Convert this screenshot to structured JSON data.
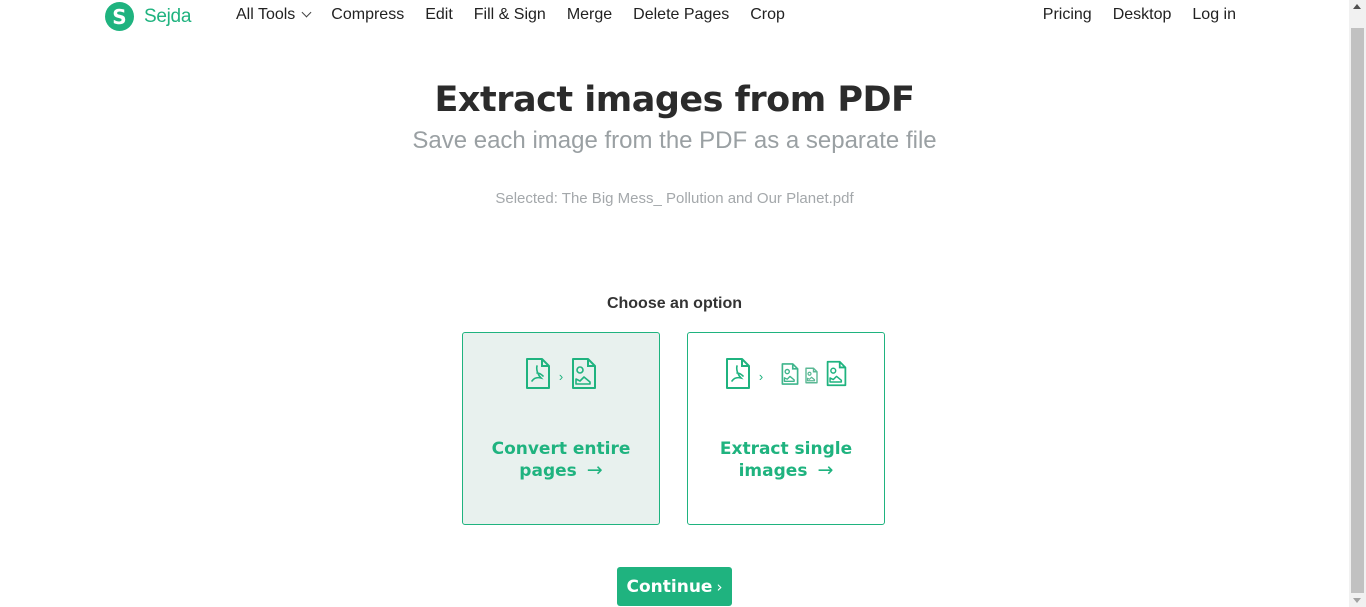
{
  "brand": {
    "logo_letter": "S",
    "name": "Sejda",
    "color": "#1fb37f"
  },
  "nav": {
    "left": [
      {
        "label": "All Tools",
        "dropdown": true
      },
      {
        "label": "Compress"
      },
      {
        "label": "Edit"
      },
      {
        "label": "Fill & Sign"
      },
      {
        "label": "Merge"
      },
      {
        "label": "Delete Pages"
      },
      {
        "label": "Crop"
      }
    ],
    "right": [
      {
        "label": "Pricing"
      },
      {
        "label": "Desktop"
      },
      {
        "label": "Log in"
      }
    ]
  },
  "hero": {
    "title": "Extract images from PDF",
    "subtitle": "Save each image from the PDF as a separate file",
    "selected": "Selected: The Big Mess_ Pollution and Our Planet.pdf"
  },
  "options": {
    "heading": "Choose an option",
    "items": [
      {
        "line1": "Convert entire",
        "line2": "pages",
        "arrow": "→",
        "selected": true,
        "icons": [
          "pdf-file-icon",
          "chevron-right-icon",
          "image-file-icon"
        ]
      },
      {
        "line1": "Extract single",
        "line2": "images",
        "arrow": "→",
        "selected": false,
        "icons": [
          "pdf-file-icon",
          "chevron-right-icon",
          "image-file-icon",
          "image-file-icon",
          "image-file-icon"
        ]
      }
    ]
  },
  "actions": {
    "continue_label": "Continue",
    "continue_chevron": "›"
  }
}
